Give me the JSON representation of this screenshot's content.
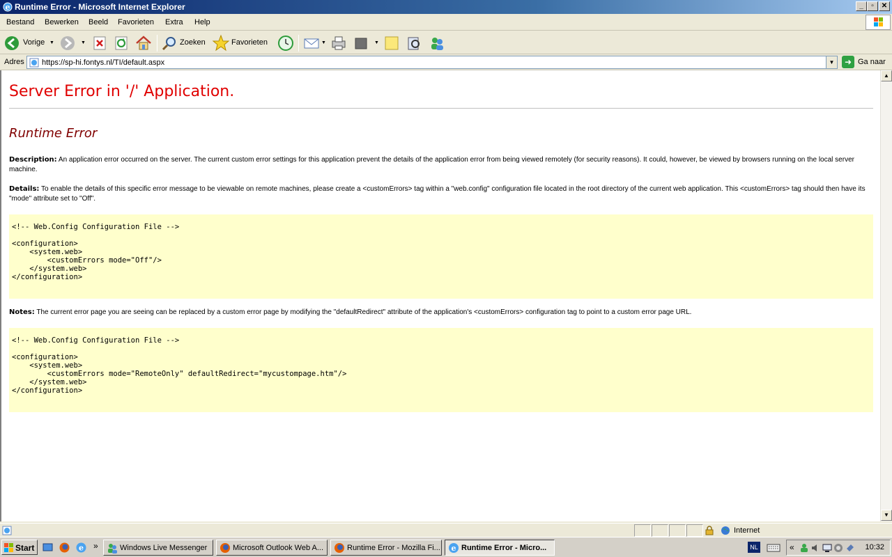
{
  "window": {
    "title": "Runtime Error - Microsoft Internet Explorer"
  },
  "menu": {
    "items": [
      "Bestand",
      "Bewerken",
      "Beeld",
      "Favorieten",
      "Extra",
      "Help"
    ]
  },
  "toolbar": {
    "back_label": "Vorige",
    "search_label": "Zoeken",
    "favorites_label": "Favorieten"
  },
  "address": {
    "label": "Adres",
    "url": "https://sp-hi.fontys.nl/TI/default.aspx",
    "go_label": "Ga naar"
  },
  "page": {
    "heading": "Server Error in '/' Application.",
    "subheading": "Runtime Error",
    "description_label": "Description:",
    "description_text": " An application error occurred on the server. The current custom error settings for this application prevent the details of the application error from being viewed remotely (for security reasons). It could, however, be viewed by browsers running on the local server machine.",
    "details_label": "Details:",
    "details_text": " To enable the details of this specific error message to be viewable on remote machines, please create a <customErrors> tag within a \"web.config\" configuration file located in the root directory of the current web application. This <customErrors> tag should then have its \"mode\" attribute set to \"Off\".",
    "code1": "<!-- Web.Config Configuration File -->\n\n<configuration>\n    <system.web>\n        <customErrors mode=\"Off\"/>\n    </system.web>\n</configuration>",
    "notes_label": "Notes:",
    "notes_text": " The current error page you are seeing can be replaced by a custom error page by modifying the \"defaultRedirect\" attribute of the application's <customErrors> configuration tag to point to a custom error page URL.",
    "code2": "<!-- Web.Config Configuration File -->\n\n<configuration>\n    <system.web>\n        <customErrors mode=\"RemoteOnly\" defaultRedirect=\"mycustompage.htm\"/>\n    </system.web>\n</configuration>"
  },
  "statusbar": {
    "zone": "Internet"
  },
  "taskbar": {
    "start_label": "Start",
    "language": "NL",
    "clock": "10:32",
    "tasks": [
      "Windows Live Messenger",
      "Microsoft Outlook Web A...",
      "Runtime Error - Mozilla Fi...",
      "Runtime Error - Micro..."
    ]
  },
  "colors": {
    "error_heading": "#e00000",
    "subheading": "#800000",
    "code_background": "#ffffcc",
    "titlebar": "#0a246a"
  }
}
